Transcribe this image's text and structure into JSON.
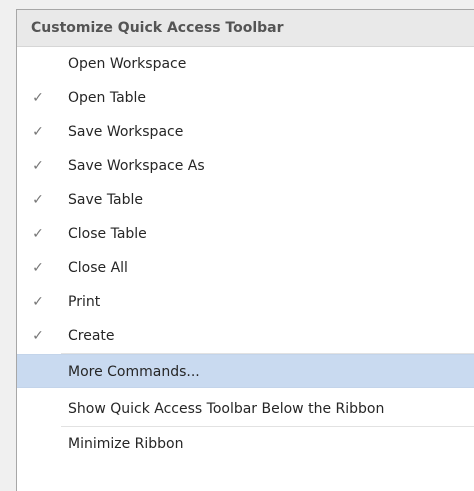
{
  "menu": {
    "title": "Customize Quick Access Toolbar",
    "check_glyph": "✓",
    "items": [
      {
        "label": "Open Workspace",
        "checked": false
      },
      {
        "label": "Open Table",
        "checked": true
      },
      {
        "label": "Save Workspace",
        "checked": true
      },
      {
        "label": "Save Workspace As",
        "checked": true
      },
      {
        "label": "Save Table",
        "checked": true
      },
      {
        "label": "Close Table",
        "checked": true
      },
      {
        "label": "Close All",
        "checked": true
      },
      {
        "label": "Print",
        "checked": true
      },
      {
        "label": "Create",
        "checked": true
      }
    ],
    "more_commands": "More Commands...",
    "show_below": "Show Quick Access Toolbar Below the Ribbon",
    "minimize_ribbon": "Minimize Ribbon",
    "colors": {
      "highlight": "#c9daf0",
      "header_bg": "#e9e9e9",
      "text": "#262626"
    }
  }
}
